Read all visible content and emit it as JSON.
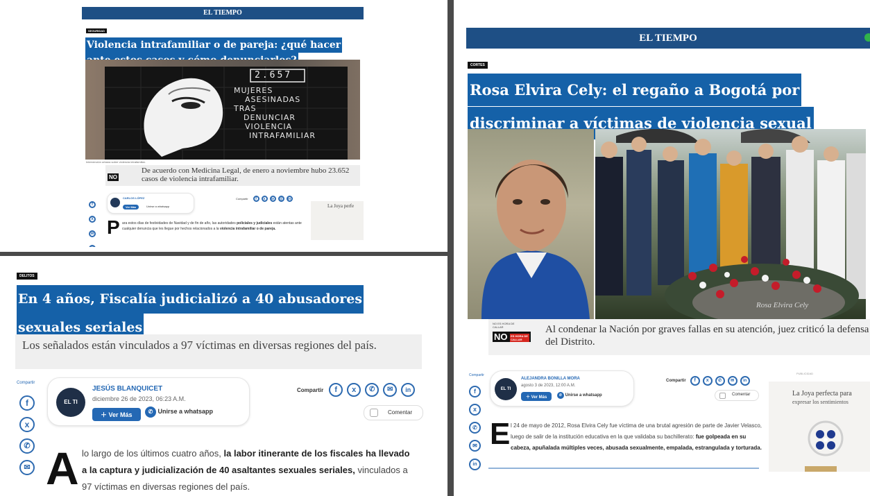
{
  "brand": {
    "masthead": "EL TIEMPO",
    "accent": "#1561a8",
    "masthead_bg": "#1e4f85"
  },
  "article_a": {
    "section": "SEGURIDAD",
    "headline_lines": [
      "Violencia intrafamiliar o de pareja: ¿qué hacer",
      "ante estos casos y cómo denunciarlos?"
    ],
    "photo_text": {
      "count": "2.657",
      "lines": [
        "MUJERES",
        "ASESINADAS",
        "TRAS",
        "DENUNCIAR",
        "VIOLENCIA",
        "INTRAFAMILIAR"
      ]
    },
    "photo_caption": "Intervención urbana sobre violencia intrafamiliar.",
    "summary": "De acuerdo con Medicina Legal, de enero a noviembre hubo 23.652 casos de violencia intrafamiliar.",
    "author": "CARLOS LÓPEZ",
    "share_label": "Compartir",
    "ver_mas": "Ver Más",
    "whatsapp": "Unirse a whatsapp",
    "ad_text": "La Joya perfe",
    "drop_cap": "P",
    "body_plain": "ara estos días de festividades de Navidad y de fin de año, las autoridades",
    "body_bold": "policiales y judiciales",
    "body_rest": "están atentas ante cualquier denuncia que les llegue por hechos relacionados a la",
    "body_bold2": "violencia intrafamiliar o de pareja."
  },
  "article_b": {
    "section": "DELITOS",
    "headline_lines": [
      "En 4 años, Fiscalía judicializó a 40 abusadores",
      "sexuales seriales"
    ],
    "summary": "Los señalados están vinculados a 97 víctimas en diversas regiones del país.",
    "share_side_label": "Compartir",
    "author": "JESÚS BLANQUICET",
    "date": "diciembre 26 de 2023, 06:23 A.M.",
    "ver_mas": "Ver Más",
    "whatsapp": "Unirse a whatsapp",
    "avatar_text": "EL TI",
    "share_label": "Compartir",
    "comment_label": "Comentar",
    "drop_cap": "A",
    "body_plain_1": "lo largo de los últimos cuatro años,",
    "body_bold": "la labor itinerante de los fiscales ha llevado a la captura y judicialización de 40 asaltantes sexuales seriales,",
    "body_plain_2": "vinculados a 97 víctimas en diversas regiones del país."
  },
  "article_c": {
    "section": "CORTES",
    "headline_lines": [
      "Rosa Elvira Cely: el regaño a Bogotá por",
      "discriminar a víctimas de violencia sexual"
    ],
    "summary": "Al condenar la Nación por graves fallas en su atención, juez criticó la defensa del Distrito.",
    "badge_top": "NO ES HORA DE CALLAR",
    "badge_no": "NO",
    "badge_red": "ES HORA DE CALLAR",
    "share_side_label": "Compartir",
    "author": "ALEJANDRA BONILLA MORA",
    "date": "agosto 3 de 2023, 12:00 A.M.",
    "ver_mas": "Ver Más",
    "whatsapp": "Unirse a whatsapp",
    "avatar_text": "EL TI",
    "share_label": "Compartir",
    "comment_label": "Comentar",
    "ad_label": "PUBLICIDAD",
    "ad_text_1": "La Joya perfecta para",
    "ad_text_2": "expresar los sentimientos",
    "drop_cap": "E",
    "body_plain": "l 24 de mayo de 2012, Rosa Elvira Cely fue víctima de una brutal agresión de parte de Javier Velasco, luego de salir de la institución educativa en la que validaba su bachillerato:",
    "body_bold": "fue golpeada en su cabeza, apuñalada múltiples veces, abusada sexualmente, empalada, estrangulada y torturada.",
    "grave_text": "Rosa Elvira Cely"
  }
}
